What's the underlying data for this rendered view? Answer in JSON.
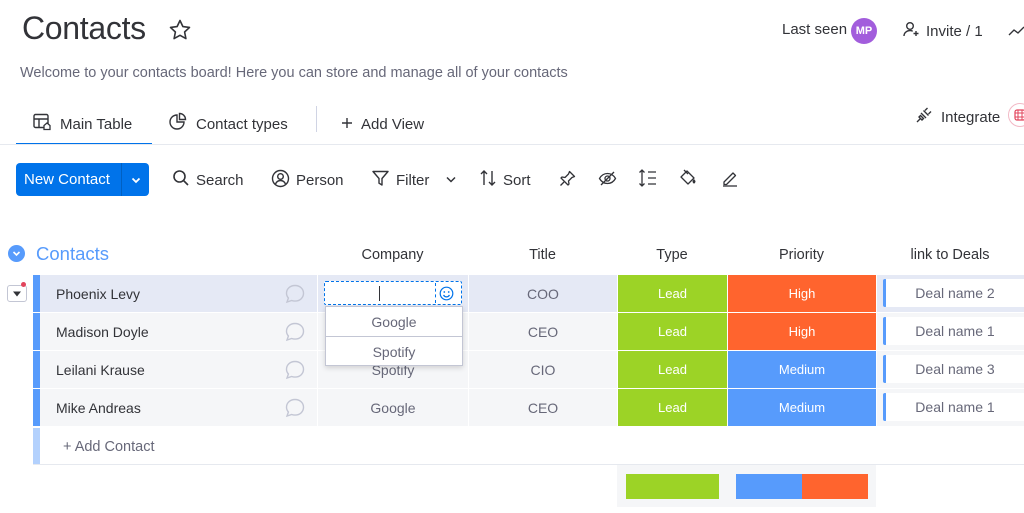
{
  "header": {
    "title": "Contacts",
    "last_seen_label": "Last seen",
    "avatar_initials": "MP",
    "invite_label": "Invite / 1",
    "description": "Welcome to your contacts board! Here you can store and manage all of your contacts"
  },
  "views": {
    "tabs": [
      {
        "label": "Main Table",
        "active": true
      },
      {
        "label": "Contact types",
        "active": false
      }
    ],
    "add_view_label": "Add View",
    "integrate_label": "Integrate"
  },
  "toolbar": {
    "new_label": "New Contact",
    "search_label": "Search",
    "person_label": "Person",
    "filter_label": "Filter",
    "sort_label": "Sort"
  },
  "group": {
    "title": "Contacts",
    "color": "#579bfc",
    "columns": [
      "Company",
      "Title",
      "Type",
      "Priority",
      "link to Deals"
    ],
    "rows": [
      {
        "name": "Phoenix Levy",
        "company": "",
        "title": "COO",
        "type": "Lead",
        "priority": "High",
        "deal": "Deal name 2"
      },
      {
        "name": "Madison Doyle",
        "company": "",
        "title": "CEO",
        "type": "Lead",
        "priority": "High",
        "deal": "Deal name 1"
      },
      {
        "name": "Leilani Krause",
        "company": "Spotify",
        "title": "CIO",
        "type": "Lead",
        "priority": "Medium",
        "deal": "Deal name 3"
      },
      {
        "name": "Mike Andreas",
        "company": "Google",
        "title": "CEO",
        "type": "Lead",
        "priority": "Medium",
        "deal": "Deal name 1"
      }
    ],
    "add_label": "+ Add Contact"
  },
  "company_editor": {
    "suggestions": [
      "Google",
      "Spotify"
    ]
  },
  "colors": {
    "lead": "#9cd326",
    "high": "#ff642e",
    "medium": "#579bfc",
    "primary": "#0073ea"
  },
  "summary": {
    "type": [
      {
        "label": "Lead",
        "share": 1.0
      }
    ],
    "priority": [
      {
        "label": "Medium",
        "share": 0.5
      },
      {
        "label": "High",
        "share": 0.5
      }
    ]
  }
}
